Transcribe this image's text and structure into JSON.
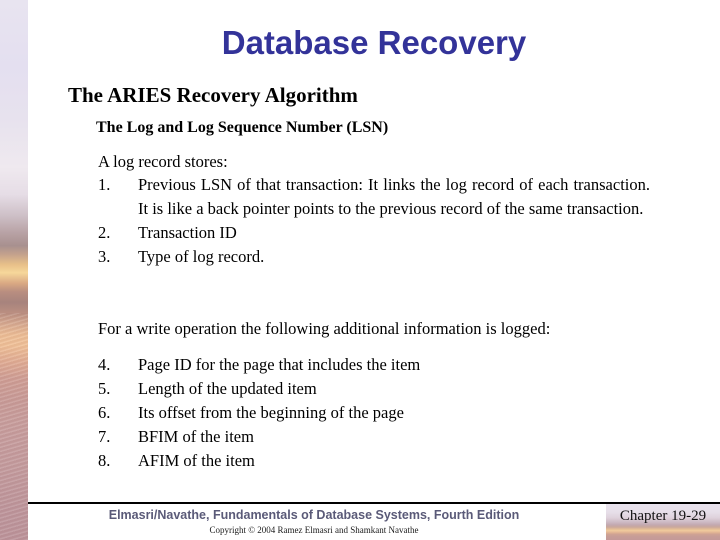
{
  "slide": {
    "title": "Database Recovery",
    "title_color": "#333399",
    "heading_1": "The ARIES Recovery Algorithm",
    "heading_2": "The Log and Log Sequence Number (LSN)",
    "intro_line": "A log record stores:",
    "write_line": "For a write operation the following additional information is logged:"
  },
  "list_a": [
    {
      "number": "1.",
      "text": "Previous LSN of that transaction:  It links the log record of each transaction.   It is like a back pointer points to the previous record of the same transaction."
    },
    {
      "number": "2.",
      "text": "Transaction ID"
    },
    {
      "number": "3.",
      "text": "Type of log record."
    }
  ],
  "list_b": [
    {
      "number": "4.",
      "text": "Page ID for the page that includes the item"
    },
    {
      "number": "5.",
      "text": "Length of the updated item"
    },
    {
      "number": "6.",
      "text": "Its offset from the beginning of the page"
    },
    {
      "number": "7.",
      "text": "BFIM of the item"
    },
    {
      "number": "8.",
      "text": "AFIM of the item"
    }
  ],
  "footer": {
    "main": "Elmasri/Navathe, Fundamentals of Database Systems, Fourth Edition",
    "main_color": "#5a5a78",
    "copyright": "Copyright © 2004 Ramez Elmasri and Shamkant Navathe",
    "chapter": "Chapter 19-29"
  }
}
